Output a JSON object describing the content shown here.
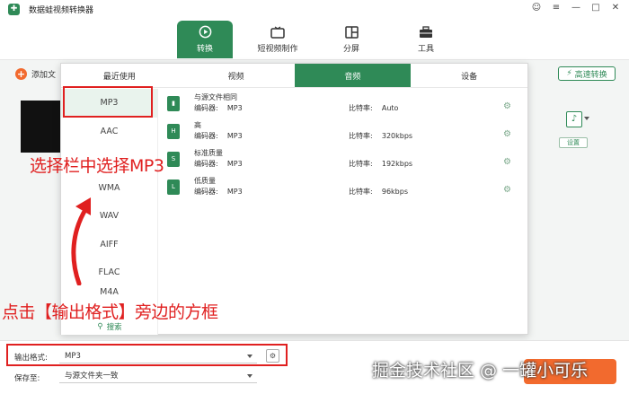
{
  "app": {
    "title": "数据蛙视频转换器"
  },
  "window_controls": [
    "☺",
    "≡",
    "—",
    "□",
    "✕"
  ],
  "nav": [
    {
      "label": "转换",
      "icon": "convert-icon",
      "active": true
    },
    {
      "label": "短视频制作",
      "icon": "tv-icon",
      "active": false
    },
    {
      "label": "分屏",
      "icon": "split-screen-icon",
      "active": false
    },
    {
      "label": "工具",
      "icon": "toolbox-icon",
      "active": false
    }
  ],
  "main": {
    "add_file_label": "添加文",
    "speed_button": "高速转换",
    "settings_label": "设置"
  },
  "popup": {
    "tabs": [
      {
        "label": "最近使用",
        "active": false
      },
      {
        "label": "视频",
        "active": false
      },
      {
        "label": "音频",
        "active": true
      },
      {
        "label": "设备",
        "active": false
      }
    ],
    "formats": [
      "MP3",
      "AAC",
      "",
      "WMA",
      "WAV",
      "AIFF",
      "FLAC",
      "M4A"
    ],
    "selected_format": "MP3",
    "search_label": "搜索",
    "presets": [
      {
        "name": "与源文件相同",
        "encoder": "编码器:    MP3",
        "bitrate": "比特率:    Auto"
      },
      {
        "name": "高",
        "encoder": "编码器:    MP3",
        "bitrate": "比特率:    320kbps"
      },
      {
        "name": "标准质量",
        "encoder": "编码器:    MP3",
        "bitrate": "比特率:    192kbps"
      },
      {
        "name": "低质量",
        "encoder": "编码器:    MP3",
        "bitrate": "比特率:    96kbps"
      }
    ]
  },
  "bottom": {
    "output_format_label": "输出格式:",
    "output_format_value": "MP3",
    "save_to_label": "保存至:",
    "save_to_value": "与源文件夹一致"
  },
  "annotations": {
    "select_mp3": "选择栏中选择MP3",
    "click_format": "点击【输出格式】旁边的方框",
    "watermark": "掘金技术社区 @ 一罐小可乐"
  },
  "colors": {
    "brand": "#2f8a57",
    "accent": "#f26a2e",
    "annotation": "#e02020"
  }
}
